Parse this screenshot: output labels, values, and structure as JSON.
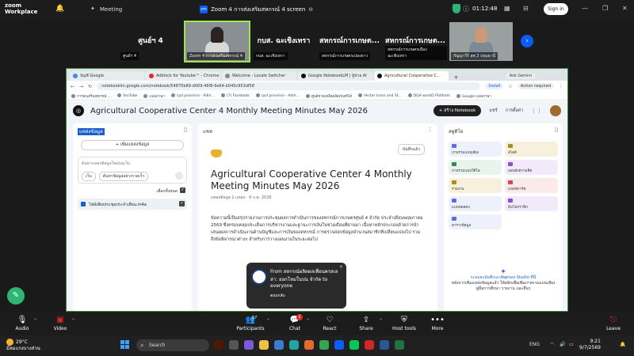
{
  "zoom_top": {
    "app_name_line1": "zoom",
    "app_name_line2": "Workplace",
    "meeting_label": "Meeting",
    "window_title": "Zoom 4 การส่งเสริมสหกรณ์ 4 screen",
    "timer": "01:12:48",
    "signin_label": "Sign in"
  },
  "gallery": {
    "tiles": [
      {
        "name": "ศูนย์ฯ 4",
        "label": "ศูนย์ฯ 4"
      },
      {
        "name": "",
        "label": "Zoom 4 การส่งเสริมสหกรณ์ 4"
      },
      {
        "name": "กบส. ฉะเชิงเทรา",
        "label": "กบส. ฉะเชิงเทรา"
      },
      {
        "name": "สหกรณ์การเกษต...",
        "label": "สหกรณ์การเกษตรเปลงยาว"
      },
      {
        "name": "สหกรณ์การเกษต...",
        "label": "สหกรณ์การเกษตรเมืองฉะเชิงเทรา"
      },
      {
        "name": "",
        "label": "กัญญาวีร์ สศ.3 ปทุมธานี"
      }
    ]
  },
  "browser": {
    "tabs": [
      {
        "label": "บัญชี Google"
      },
      {
        "label": "Adblock for Youtube™ - Chrome"
      },
      {
        "label": "Welcome - Locale Switcher"
      },
      {
        "label": "Google NotebookLM | ผู้ช่วย AI"
      },
      {
        "label": "Agricultural Cooperative C..."
      }
    ],
    "ask_gemini": "Ask Gemini",
    "url": "notebooklm.google.com/notebook/54875b89-d009-46f8-9e64-b045c953df58",
    "install_label": "Install",
    "action_required": "Action required",
    "bookmarks": [
      "การส่งเสริมสหกรณ์ ...",
      "YouTube",
      "แปลภาษา",
      "cpd province - Adm...",
      "(7) Facebook",
      "cpd province - Adm...",
      "ศูนย์ช่วยเหลือผลิตภัณฑ์ได้",
      "Vector Icons and St...",
      "DGA workD Platform",
      "Google แปลภาษา"
    ]
  },
  "notebook": {
    "title": "Agricultural Cooperative Center 4 Monthly Meeting Minutes May 2026",
    "create_label": "+ สร้าง Notebook",
    "share_label": "แชร์",
    "settings_label": "การตั้งค่า",
    "sources_header": "แหล่งข้อมูล",
    "add_source": "+ เพิ่มแหล่งข้อมูล",
    "search_placeholder": "ค้นหาแหล่งข้อมูลใหม่บนเว็บ",
    "chip_web": "เว็บ",
    "chip_fast": "ค้นหาข้อมูลอย่างรวดเร็ว",
    "select_all": "เลือกทั้งหมด",
    "source_item": "ไฟล์เสียงประชุมประจำเดือน.m4a",
    "chat_header": "แชท",
    "save_note": "บันทึกแล้ว",
    "chat_title": "Agricultural Cooperative Center 4 Monthly Meeting Minutes May 2026",
    "chat_meta": "แหล่งข้อมูล 1 แหล่ง · 9 ก.ค. 2026",
    "chat_text": "ข้อความนี้เป็นสรุปรายงานการประชุมผลการดำเนินการของสหกรณ์การเกษตรศูนย์ 4 จำกัด ประจำเดือนพฤษภาคม 2569 ซึ่งครอบคลุมประเด็นการบริหารงานและฐานะการเงินในช่วงเดือนที่ผ่านมา เนื้อหาหลักประกอบด้วยการนำเสนอผลการดำเนินงานด้านบัญชีและการเงินของสหกรณ์ การตรวจสอบข้อมูลจำนวนสมาชิกที่เปลี่ยนแปลงไป รวมถึงข้อพิจารณาต่างๆ สำหรับการวางแผนงานในระยะต่อไป",
    "studio_header": "สตูดิโอ",
    "studio_cards": [
      {
        "label": "ภาพรวมแบบเสียง"
      },
      {
        "label": "สไลด์"
      },
      {
        "label": "ภาพรวมแบบวิดีโอ"
      },
      {
        "label": "แผนผังความคิด"
      },
      {
        "label": "รายงาน"
      },
      {
        "label": "แฟลชการ์ด"
      },
      {
        "label": "แบบทดสอบ"
      },
      {
        "label": "อินโฟกราฟิก"
      },
      {
        "label": "ตารางข้อมูล"
      }
    ],
    "studio_foot_1": "ระบบจะบันทึกเอาต์พุตของ Studio ที่นี่",
    "studio_foot_2": "หลังจากเพิ่มแหล่งข้อมูลแล้ว ให้คลิกเพื่อเพิ่มภาพรวมแบบเสียง",
    "studio_foot_3": "คู่มือการศึกษา รายงาน และอื่นๆ"
  },
  "toast": {
    "message": "From สหกรณ์ผลิตผลเพื่อนครสเลล่า: ออกโหมในบ่น จำกัด to everyone",
    "reply": "ตอบกลับ"
  },
  "zoom_bar": {
    "audio": "Audio",
    "video": "Video",
    "participants": "Participants",
    "participants_count": "57",
    "chat": "Chat",
    "chat_badge": "1",
    "react": "React",
    "share": "Share",
    "host_tools": "Host tools",
    "more": "More",
    "leave": "Leave"
  },
  "taskbar": {
    "temperature": "29°C",
    "weather": "มีลมแรงบางส่วน",
    "search_placeholder": "Search",
    "lang": "ENG",
    "time": "9:21",
    "date": "9/7/2569"
  },
  "colors": {
    "zoom_blue": "#0b5cff",
    "active_speaker": "#9be64b",
    "leave_red": "#e02828"
  }
}
